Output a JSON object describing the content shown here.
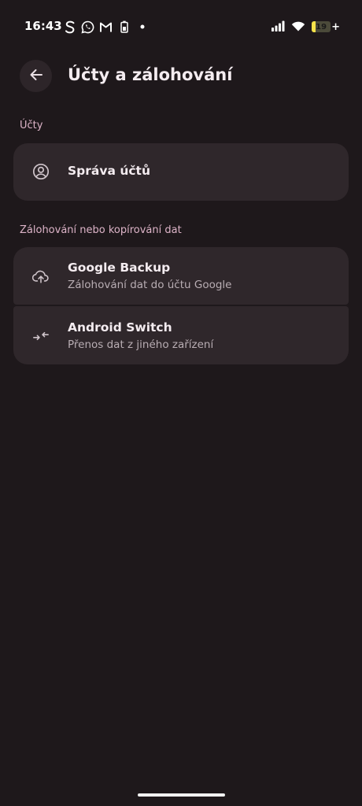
{
  "status_bar": {
    "time": "16:43",
    "left_icons": [
      "s-icon",
      "whatsapp-icon",
      "gmail-icon",
      "battery-saver-icon",
      "dot-icon"
    ],
    "right_icons": [
      "signal-icon",
      "wifi-icon",
      "battery-icon"
    ],
    "battery_level": "19",
    "battery_fraction": 0.19,
    "battery_charging_symbol": "+"
  },
  "app_bar": {
    "back_icon": "arrow-back-icon",
    "title": "Účty a zálohování"
  },
  "sections": [
    {
      "header": "Účty",
      "items": [
        {
          "icon": "account-circle-icon",
          "title": "Správa účtů"
        }
      ]
    },
    {
      "header": "Zálohování nebo kopírování dat",
      "items": [
        {
          "icon": "cloud-upload-icon",
          "title": "Google Backup",
          "subtitle": "Zálohování dat do účtu Google"
        },
        {
          "icon": "transfer-arrows-icon",
          "title": "Android Switch",
          "subtitle": "Přenos dat z jiného zařízení"
        }
      ]
    }
  ],
  "colors": {
    "background": "#1e181b",
    "card": "#2f272b",
    "section_header": "#ddb4c8",
    "battery_fill": "#f6e24a"
  }
}
